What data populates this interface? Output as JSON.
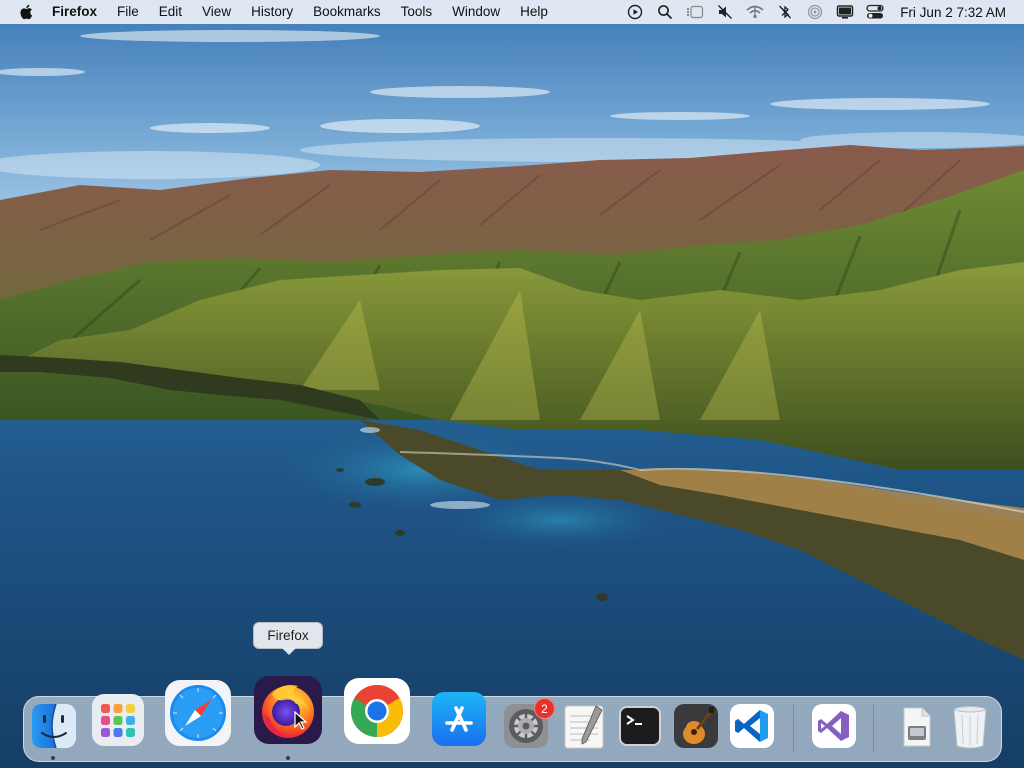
{
  "menubar": {
    "app_name": "Firefox",
    "menus": [
      "File",
      "Edit",
      "View",
      "History",
      "Bookmarks",
      "Tools",
      "Window",
      "Help"
    ],
    "clock": "Fri Jun 2  7:32 AM",
    "status_icons": [
      "screen-record-icon",
      "spotlight-search-icon",
      "stage-manager-icon",
      "mute-icon",
      "wifi-icon",
      "no-bluetooth-icon",
      "airdrop-icon",
      "display-icon",
      "control-center-icon"
    ]
  },
  "tooltip": {
    "text": "Firefox"
  },
  "dock": {
    "items": [
      {
        "name": "Finder",
        "icon": "finder-icon",
        "running": true
      },
      {
        "name": "Launchpad",
        "icon": "launchpad-icon",
        "running": false
      },
      {
        "name": "Safari",
        "icon": "safari-icon",
        "running": false
      },
      {
        "name": "Firefox",
        "icon": "firefox-icon",
        "running": true
      },
      {
        "name": "Google Chrome",
        "icon": "chrome-icon",
        "running": false
      },
      {
        "name": "App Store",
        "icon": "app-store-icon",
        "running": false
      },
      {
        "name": "System Preferences",
        "icon": "system-preferences-icon",
        "running": false,
        "badge": "2"
      },
      {
        "name": "TextEdit",
        "icon": "textedit-icon",
        "running": false
      },
      {
        "name": "Terminal",
        "icon": "terminal-icon",
        "running": false
      },
      {
        "name": "GarageBand",
        "icon": "garageband-icon",
        "running": false
      },
      {
        "name": "Visual Studio Code",
        "icon": "vscode-icon",
        "running": false
      },
      {
        "name": "Visual Studio",
        "icon": "visual-studio-icon",
        "running": false
      },
      {
        "name": "Downloads",
        "icon": "downloads-stack-icon",
        "running": false
      },
      {
        "name": "Trash",
        "icon": "trash-icon",
        "running": false
      }
    ]
  },
  "colors": {
    "menubar_bg": "#ECF0F6",
    "badge": "#E8312B",
    "sky_top": "#3F7DBB",
    "ocean": "#1E5684"
  }
}
